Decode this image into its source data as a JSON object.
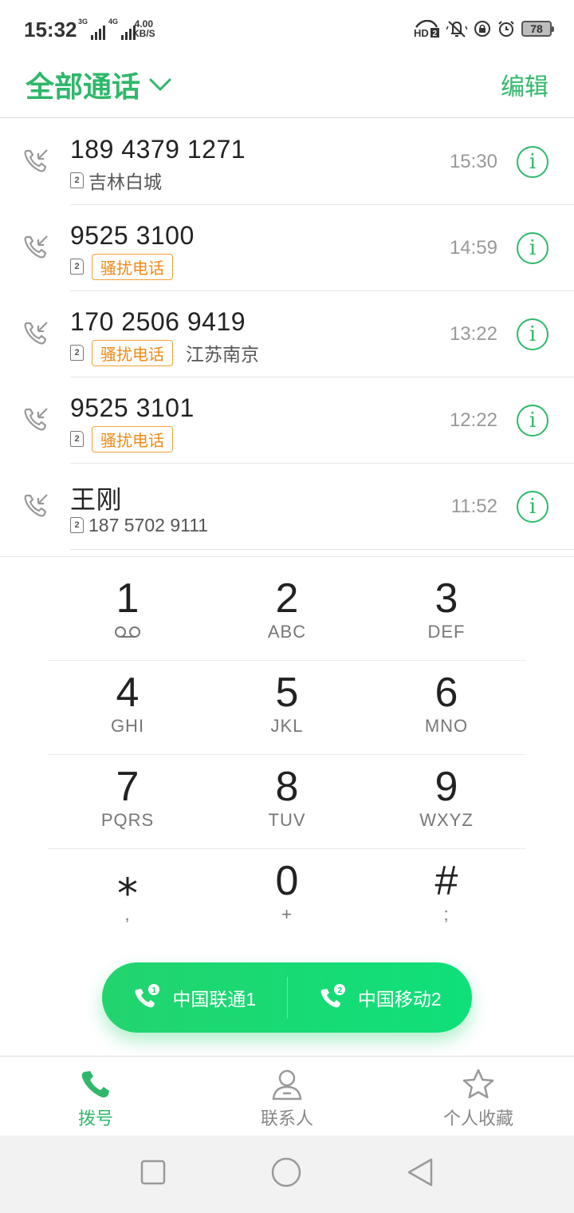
{
  "status_bar": {
    "time": "15:32",
    "net1": "3G",
    "net2": "4G",
    "speed_value": "4.00",
    "speed_unit": "KB/S",
    "battery": "78"
  },
  "header": {
    "title": "全部通话",
    "edit_label": "编辑"
  },
  "calls": [
    {
      "name": "189 4379 1271",
      "sim": "2",
      "tag": "",
      "location": "吉林白城",
      "time": "15:30"
    },
    {
      "name": "9525 3100",
      "sim": "2",
      "tag": "骚扰电话",
      "location": "",
      "time": "14:59"
    },
    {
      "name": "170 2506 9419",
      "sim": "2",
      "tag": "骚扰电话",
      "location": "江苏南京",
      "time": "13:22"
    },
    {
      "name": "9525 3101",
      "sim": "2",
      "tag": "骚扰电话",
      "location": "",
      "time": "12:22"
    },
    {
      "name": "王刚",
      "sim": "2",
      "tag": "",
      "location": "187 5702 9111",
      "time": "11:52"
    }
  ],
  "keypad": [
    {
      "digit": "1",
      "letters": ""
    },
    {
      "digit": "2",
      "letters": "ABC"
    },
    {
      "digit": "3",
      "letters": "DEF"
    },
    {
      "digit": "4",
      "letters": "GHI"
    },
    {
      "digit": "5",
      "letters": "JKL"
    },
    {
      "digit": "6",
      "letters": "MNO"
    },
    {
      "digit": "7",
      "letters": "PQRS"
    },
    {
      "digit": "8",
      "letters": "TUV"
    },
    {
      "digit": "9",
      "letters": "WXYZ"
    },
    {
      "digit": "⁎",
      "letters": ","
    },
    {
      "digit": "0",
      "letters": "+"
    },
    {
      "digit": "#",
      "letters": ";"
    }
  ],
  "sim_buttons": [
    {
      "label": "中国联通1",
      "badge": "1"
    },
    {
      "label": "中国移动2",
      "badge": "2"
    }
  ],
  "bottom_nav": [
    {
      "label": "拨号",
      "icon": "phone-icon",
      "active": true
    },
    {
      "label": "联系人",
      "icon": "person-icon",
      "active": false
    },
    {
      "label": "个人收藏",
      "icon": "star-icon",
      "active": false
    }
  ],
  "colors": {
    "accent": "#2fb86a",
    "spam_tag": "#f08a16",
    "dial_button": "#1ad873"
  }
}
